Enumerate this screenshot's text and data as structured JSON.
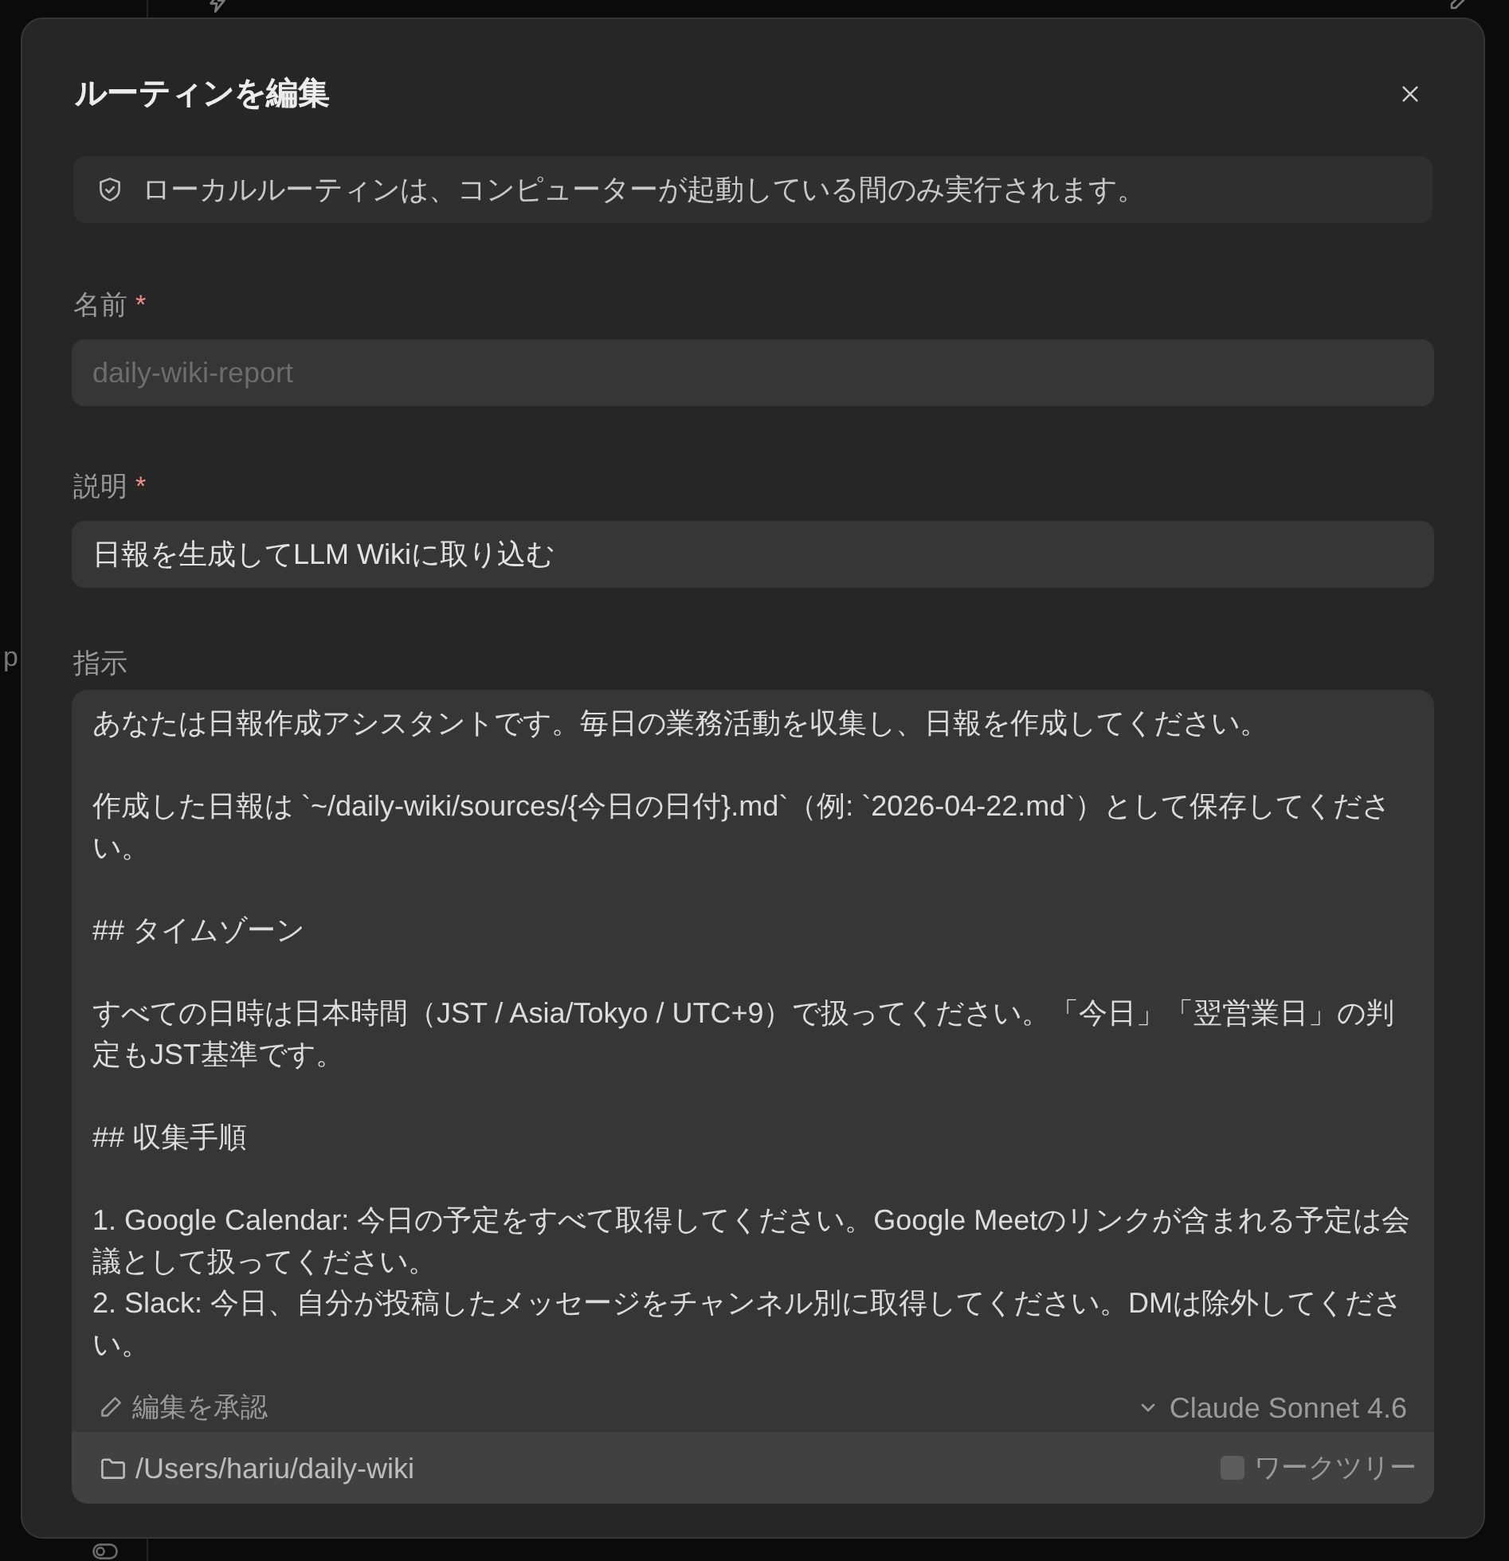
{
  "background": {
    "left_fragment": "p"
  },
  "dialog": {
    "title": "ルーティンを編集",
    "notice": "ローカルルーティンは、コンピューターが起動している間のみ実行されます。",
    "fields": [
      {
        "kind": "input",
        "label": "名前",
        "required_mark": "*",
        "value": "daily-wiki-report",
        "disabled": true
      },
      {
        "kind": "input",
        "label": "説明",
        "required_mark": "*",
        "value": "日報を生成してLLM Wikiに取り込む",
        "disabled": false
      },
      {
        "kind": "textarea",
        "label": "指示",
        "paragraphs": [
          [
            "あなたは日報作成アシスタントです。毎日の業務活動を収集し、日報を作成してください。"
          ],
          [
            "作成した日報は `~/daily-wiki/sources/{今日の日付}.md`（例: `2026-04-22.md`）として保存してください。"
          ],
          [
            "## タイムゾーン"
          ],
          [
            "すべての日時は日本時間（JST / Asia/Tokyo / UTC+9）で扱ってください。「今日」「翌営業日」の判定もJST基準です。"
          ],
          [
            "## 収集手順"
          ],
          [
            "1. Google Calendar: 今日の予定をすべて取得してください。Google Meetのリンクが含まれる予定は会議として扱ってください。",
            "2. Slack: 今日、自分が投稿したメッセージをチャンネル別に取得してください。DMは除外してください。"
          ]
        ]
      }
    ],
    "footer": {
      "approve_edits": "編集を承認",
      "model": "Claude Sonnet 4.6",
      "folder": "/Users/hariu/daily-wiki",
      "worktree": {
        "label": "ワークツリー",
        "checked": false
      }
    }
  }
}
